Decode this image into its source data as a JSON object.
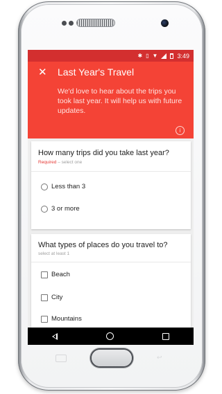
{
  "status_bar": {
    "time": "3:49",
    "bluetooth_icon": "bluetooth-icon",
    "vibrate_icon": "vibrate-icon",
    "wifi_icon": "wifi-icon",
    "signal_icon": "signal-icon",
    "battery_icon": "battery-icon"
  },
  "header": {
    "close_icon": "close-icon",
    "title": "Last Year's Travel",
    "description": "We'd love to hear about the trips you took last year. It will help us with future updates.",
    "info_icon": "info-icon",
    "color": "#f44336",
    "status_color": "#d32f2f"
  },
  "question1": {
    "title": "How many trips did you take last year?",
    "required": "Required",
    "hint": "– select one",
    "options": [
      "Less than 3",
      "3 or more"
    ]
  },
  "question2": {
    "title": "What types of places do you travel to?",
    "hint": "select at least 1",
    "options": [
      "Beach",
      "City",
      "Mountains"
    ]
  },
  "nav_bar": {
    "back_icon": "back-triangle-icon",
    "home_icon": "home-circle-icon",
    "recent_icon": "recent-square-icon"
  }
}
